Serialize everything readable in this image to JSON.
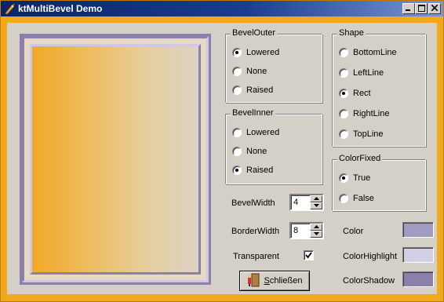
{
  "window": {
    "title": "ktMultiBevel Demo",
    "minimize_label": "_",
    "close_label": "✕"
  },
  "colors": {
    "title_bar": "#0a246a",
    "frame": "#f2a81b",
    "color": "#a19ac2",
    "color_highlight": "#d3cfe6",
    "color_shadow": "#8b80ab"
  },
  "bevel_outer": {
    "title": "BevelOuter",
    "options": [
      {
        "label": "Lowered",
        "checked": true
      },
      {
        "label": "None",
        "checked": false
      },
      {
        "label": "Raised",
        "checked": false
      }
    ]
  },
  "bevel_inner": {
    "title": "BevelInner",
    "options": [
      {
        "label": "Lowered",
        "checked": false
      },
      {
        "label": "None",
        "checked": false
      },
      {
        "label": "Raised",
        "checked": true
      }
    ]
  },
  "shape": {
    "title": "Shape",
    "options": [
      {
        "label": "BottomLine",
        "checked": false
      },
      {
        "label": "LeftLine",
        "checked": false
      },
      {
        "label": "Rect",
        "checked": true
      },
      {
        "label": "RightLine",
        "checked": false
      },
      {
        "label": "TopLine",
        "checked": false
      }
    ]
  },
  "color_fixed": {
    "title": "ColorFixed",
    "options": [
      {
        "label": "True",
        "checked": true
      },
      {
        "label": "False",
        "checked": false
      }
    ]
  },
  "bevel_width": {
    "label": "BevelWidth",
    "value": "4"
  },
  "border_width": {
    "label": "BorderWidth",
    "value": "8"
  },
  "transparent": {
    "label": "Transparent",
    "checked": true
  },
  "swatches": {
    "color_label": "Color",
    "highlight_label": "ColorHighlight",
    "shadow_label": "ColorShadow"
  },
  "close_button": {
    "label_prefix": "S",
    "label_rest": "chließen"
  }
}
